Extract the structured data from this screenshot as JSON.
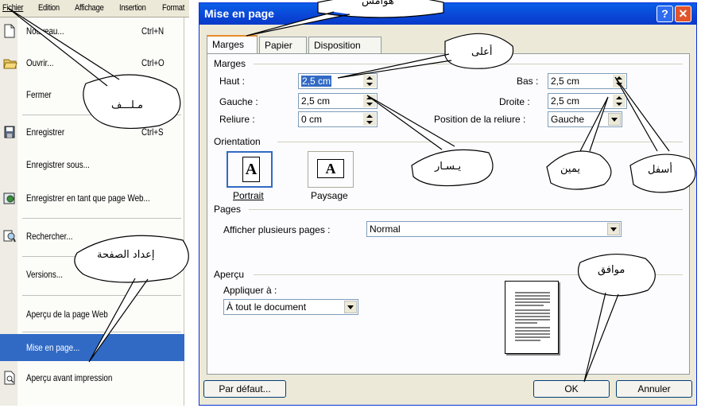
{
  "menubar": {
    "items": [
      "Fichier",
      "Edition",
      "Affichage",
      "Insertion",
      "Format"
    ]
  },
  "file_menu": {
    "items": [
      {
        "label": "Nouveau...",
        "shortcut": "Ctrl+N",
        "icon": "new-document-icon"
      },
      {
        "label": "Ouvrir...",
        "shortcut": "Ctrl+O",
        "icon": "open-folder-icon"
      },
      {
        "label": "Fermer",
        "shortcut": ""
      },
      {
        "label": "Enregistrer",
        "shortcut": "Ctrl+S",
        "icon": "save-disk-icon"
      },
      {
        "label": "Enregistrer sous...",
        "shortcut": ""
      },
      {
        "label": "Enregistrer en tant que page Web...",
        "shortcut": "",
        "icon": "web-page-icon"
      },
      {
        "label": "Rechercher...",
        "shortcut": "",
        "icon": "search-icon"
      },
      {
        "label": "Versions...",
        "shortcut": ""
      },
      {
        "label": "Aperçu de la page Web",
        "shortcut": ""
      },
      {
        "label": "Mise en page...",
        "shortcut": "",
        "highlighted": true
      },
      {
        "label": "Aperçu avant impression",
        "shortcut": "",
        "icon": "print-preview-icon"
      }
    ]
  },
  "dialog": {
    "title": "Mise en page",
    "help": "?",
    "close": "✕",
    "tabs": [
      "Marges",
      "Papier",
      "Disposition"
    ],
    "active_tab": "Marges",
    "margins": {
      "group": "Marges",
      "haut_label": "Haut :",
      "haut": "2,5 cm",
      "bas_label": "Bas :",
      "bas": "2,5 cm",
      "gauche_label": "Gauche :",
      "gauche": "2,5 cm",
      "droite_label": "Droite :",
      "droite": "2,5 cm",
      "reliure_label": "Reliure :",
      "reliure": "0 cm",
      "position_label": "Position de la reliure :",
      "position": "Gauche"
    },
    "orientation": {
      "group": "Orientation",
      "portrait": "Portrait",
      "paysage": "Paysage",
      "glyph": "A"
    },
    "pages": {
      "group": "Pages",
      "label": "Afficher plusieurs pages :",
      "value": "Normal"
    },
    "apercu": {
      "group": "Aperçu",
      "apply_label": "Appliquer à :",
      "apply_value": "À tout le document"
    },
    "buttons": {
      "default": "Par défaut...",
      "ok": "OK",
      "cancel": "Annuler"
    }
  },
  "callouts": {
    "hawamish": "هوامش",
    "milaf": "مـلـــف",
    "aala": "أعلى",
    "yasar": "يـسـار",
    "yamin": "يمين",
    "asfal": "أسفل",
    "idad": "إعداد الصفحة",
    "muwafiq": "موافق"
  },
  "colors": {
    "title_bar": "#0a46d6",
    "highlight": "#316ac5",
    "dialog_bg": "#ece9d8"
  }
}
